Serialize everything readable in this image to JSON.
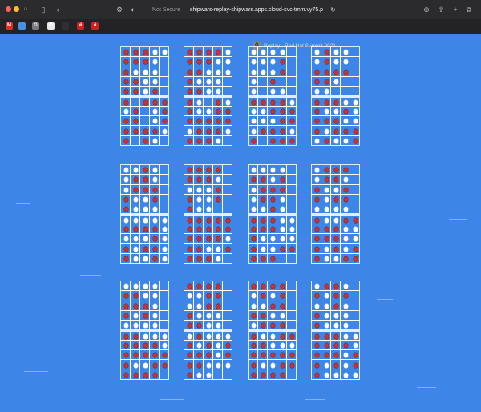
{
  "browser": {
    "address_security": "Not Secure —",
    "address_host": "shipwars-replay-shipwars.apps.cloud-svc-tmm.vy75.p",
    "tab_title": "Replay - Red Hat Summit 2021",
    "tab_favicon_glyph": "G",
    "toolbar_icons": [
      "sidebar-icon",
      "back-icon",
      "shield-icon",
      "theme-icon",
      "download-icon",
      "share-icon",
      "new-tab-icon",
      "tabs-overview-icon"
    ],
    "bookmark_icons": [
      {
        "name": "gmail-bookmark-icon",
        "glyph": "M",
        "color": "#d93025"
      },
      {
        "name": "bookmark-icon-2",
        "glyph": "",
        "color": "#4a90e2"
      },
      {
        "name": "bookmark-icon-3",
        "glyph": "G",
        "color": "#7a7a80"
      },
      {
        "name": "github-bookmark-icon",
        "glyph": "O",
        "color": "#e8e8e8"
      },
      {
        "name": "bookmark-icon-5",
        "glyph": "",
        "color": "#2f2f33"
      },
      {
        "name": "redhat-bookmark-icon",
        "glyph": "#",
        "color": "#cc2222"
      },
      {
        "name": "bookmark-icon-7",
        "glyph": "#",
        "color": "#cc2222"
      }
    ]
  },
  "colors": {
    "background": "#3d86e8",
    "hit": "#c8332f",
    "miss": "#ffffff",
    "grid": "#ffffff"
  },
  "boards": [
    [
      "HHHMM",
      "HHHM.",
      "HMMM.",
      "HHMM.",
      "HHMH.",
      "H.HHH",
      "MH.MH",
      "HH.MH",
      "HHHHM",
      "H.HM."
    ],
    [
      "HHHHM",
      "HHHMM",
      "HHMMM",
      "HMMM.",
      "HHMM.",
      "HM.HM",
      "HMMHH",
      "HHHHH",
      "MHHHM",
      "HHHM."
    ],
    [
      "MMMM.",
      "MMMH.",
      "MMMH.",
      "M.H..",
      "M.MM.",
      "HHHHM",
      "MMHHH",
      "MMMHH",
      "MHHHM",
      "H.HHH"
    ],
    [
      "MHMM.",
      "MHMM.",
      "HHHH.",
      "HHM..",
      "MM...",
      "HHHMM",
      "HMMHM",
      "HHHMM",
      "HMHHH",
      "MHMMH"
    ],
    [
      "MMHM.",
      "MHHM.",
      "MHHH.",
      "HMMH.",
      "HMMM.",
      "MMMMM",
      "HHHHM",
      "MMMHM",
      "HMHHM",
      "HMMHM"
    ],
    [
      "HHHH.",
      "HHHM.",
      "MMMH.",
      "HMMH.",
      "HMM..",
      "HHHHH",
      "HHHHH",
      "HHHHM",
      "HHMMH",
      "HHHM."
    ],
    [
      "MMMM.",
      "HHMH.",
      "MHHH.",
      "MHHM.",
      "MMHM.",
      "HHHMM",
      "HHHMM",
      "HMMMM",
      "HMMHH",
      "HHH.."
    ],
    [
      "MHHH.",
      "MHHM.",
      "HMMH.",
      "HMHH.",
      "MMMM.",
      "HMMHH",
      "HHHMM",
      "HHHMM",
      "HMHMH",
      "HMMHH"
    ],
    [
      "MMMM.",
      "HHMM.",
      "HHHM.",
      "HMHM.",
      "MMMM.",
      "HHMMM",
      "HHHHM",
      "HHHHH",
      "HMMHH",
      "HHHH."
    ],
    [
      "HHHH.",
      "MMHH.",
      "MMHH.",
      "HMMM.",
      "HHMM.",
      "MHMMM",
      "HMHMH",
      "HHHMH",
      "HHMMM",
      "HMM.."
    ],
    [
      "HHHH.",
      "MHMH.",
      "MMHH.",
      "HHMM.",
      "MHHH.",
      "HMMHH",
      "HHMMM",
      "HHHHH",
      "HMMHH",
      "HHHH."
    ],
    [
      "MHHM.",
      "HMHH.",
      "MMHM.",
      "HMMM.",
      "HMMM.",
      "HHHMM",
      "HHHHM",
      "HHHMH",
      "HMHMH",
      "HMMMM"
    ]
  ]
}
